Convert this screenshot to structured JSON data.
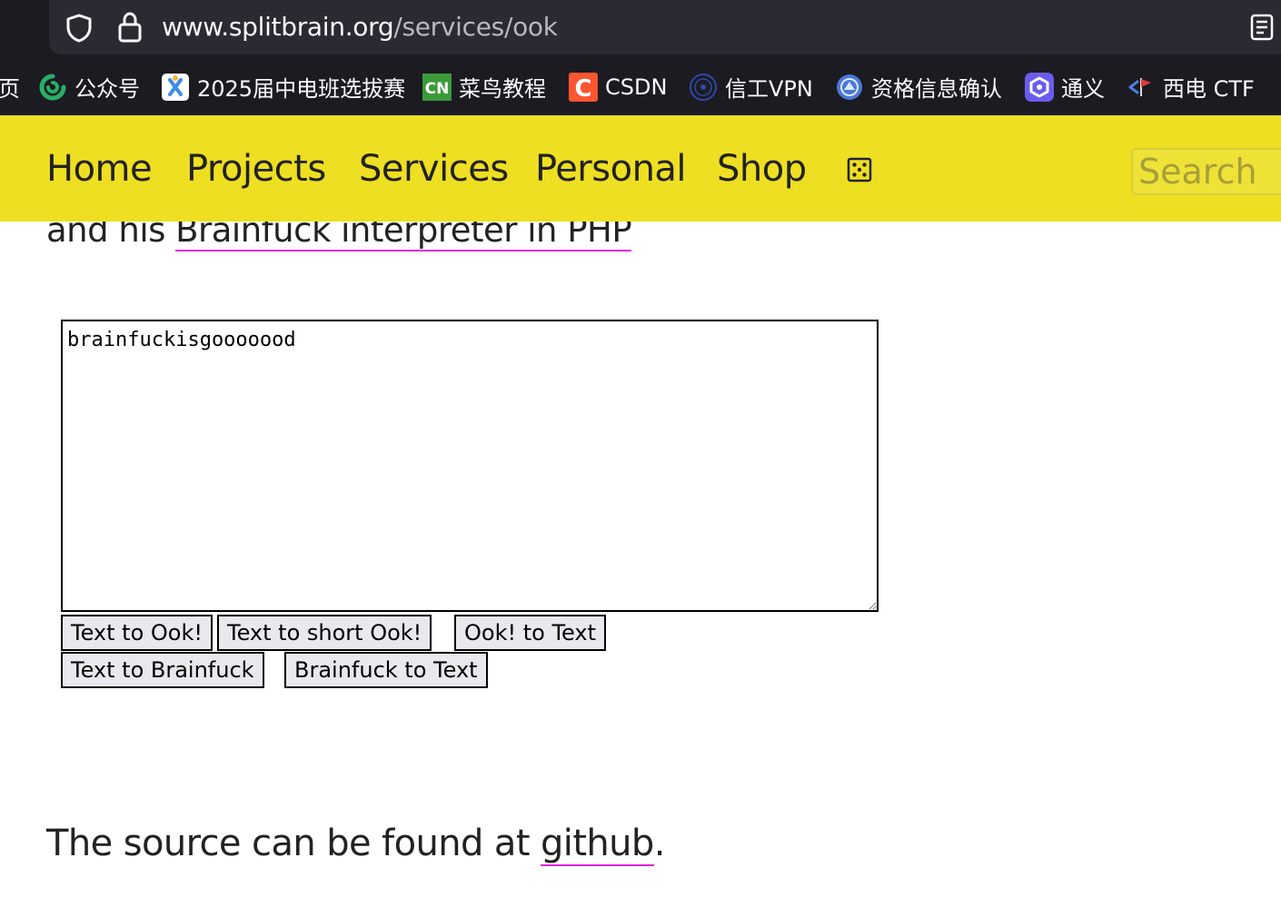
{
  "browser": {
    "url_host": "www.splitbrain.org",
    "url_path": "/services/ook",
    "icons": [
      "shield-icon",
      "lock-icon",
      "reader-view-icon"
    ]
  },
  "bookmarks": [
    {
      "label": "页",
      "icon": "none"
    },
    {
      "label": "公众号",
      "icon": "wechat-official-icon"
    },
    {
      "label": "2025届中电班选拔赛",
      "icon": "contest-icon"
    },
    {
      "label": "菜鸟教程",
      "icon": "runoob-cn-icon",
      "icon_text": "CN"
    },
    {
      "label": "CSDN",
      "icon": "csdn-icon",
      "icon_text": "C"
    },
    {
      "label": "信工VPN",
      "icon": "university-seal-icon"
    },
    {
      "label": "资格信息确认",
      "icon": "university-badge-icon"
    },
    {
      "label": "通义",
      "icon": "tongyi-icon"
    },
    {
      "label": "西电 CTF",
      "icon": "ctf-flag-icon"
    }
  ],
  "nav": {
    "items": [
      "Home",
      "Projects",
      "Services",
      "Personal",
      "Shop"
    ],
    "random_icon": "dice-icon",
    "search_placeholder": "Search"
  },
  "content": {
    "intro_prefix": "and his ",
    "intro_link": "Brainfuck interpreter in PHP",
    "textarea_value": "brainfuckisgooooood",
    "buttons_row1": [
      "Text to Ook!",
      "Text to short Ook!",
      "Ook! to Text"
    ],
    "buttons_row2": [
      "Text to Brainfuck",
      "Brainfuck to Text"
    ],
    "source_prefix": "The source can be found at ",
    "source_link": "github",
    "source_suffix": "."
  },
  "colors": {
    "nav_background": "#eedf22",
    "link_underline": "#e222e0",
    "chrome_background": "#1c1b22",
    "urlbar_background": "#2b2a33"
  }
}
